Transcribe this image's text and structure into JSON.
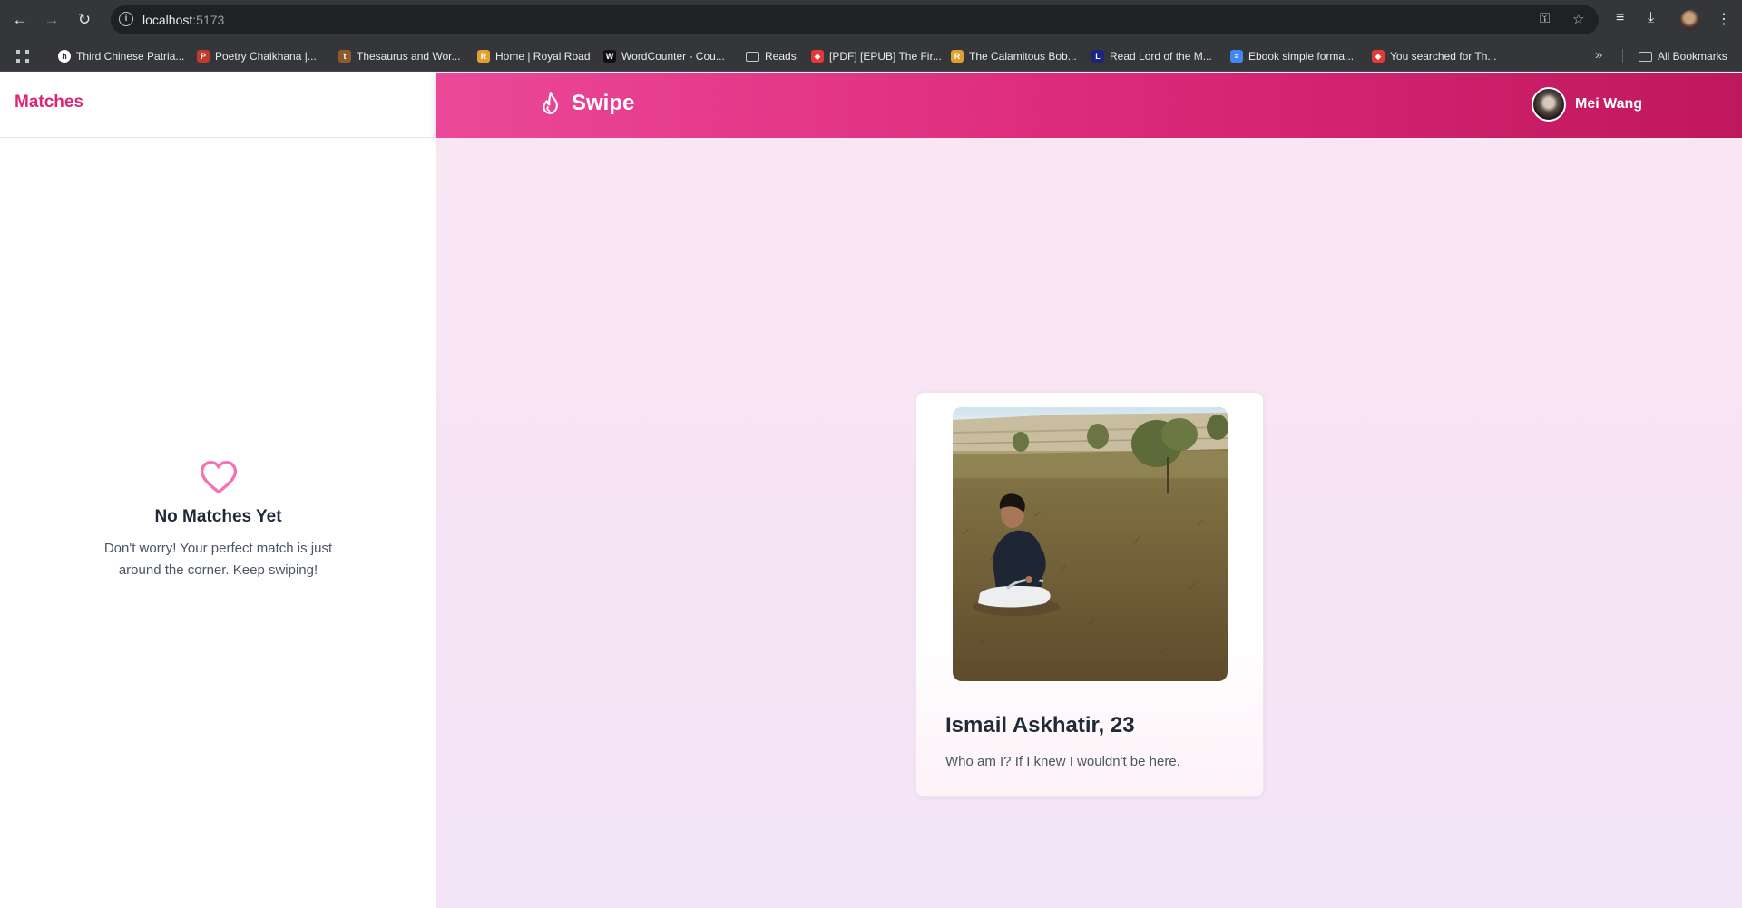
{
  "browser": {
    "url_host": "localhost",
    "url_port": ":5173",
    "bookmarks": [
      {
        "label": "Third Chinese Patria...",
        "color": "#ffffff"
      },
      {
        "label": "Poetry Chaikhana |...",
        "color": "#c0392b"
      },
      {
        "label": "Thesaurus and Wor...",
        "color": "#8d5a2b"
      },
      {
        "label": "Home | Royal Road",
        "color": "#e0a030"
      },
      {
        "label": "WordCounter - Cou...",
        "color": "#111111"
      },
      {
        "label": "Reads",
        "color": "folder"
      },
      {
        "label": "[PDF] [EPUB] The Fir...",
        "color": "#e53935"
      },
      {
        "label": "The Calamitous Bob...",
        "color": "#e0a030"
      },
      {
        "label": "Read Lord of the M...",
        "color": "#1a237e"
      },
      {
        "label": "Ebook simple forma...",
        "color": "#4285f4"
      },
      {
        "label": "You searched for Th...",
        "color": "#e53935"
      }
    ],
    "all_bookmarks": "All Bookmarks"
  },
  "sidebar": {
    "title": "Matches",
    "empty_title": "No Matches Yet",
    "empty_desc": "Don't worry! Your perfect match is just around the corner. Keep swiping!"
  },
  "header": {
    "brand": "Swipe",
    "user_name": "Mei Wang"
  },
  "card": {
    "name_age": "Ismail Askhatir, 23",
    "bio": "Who am I? If I knew I wouldn't be here."
  },
  "colors": {
    "accent": "#db2777",
    "header_start": "#ec4899",
    "header_end": "#be185d"
  }
}
